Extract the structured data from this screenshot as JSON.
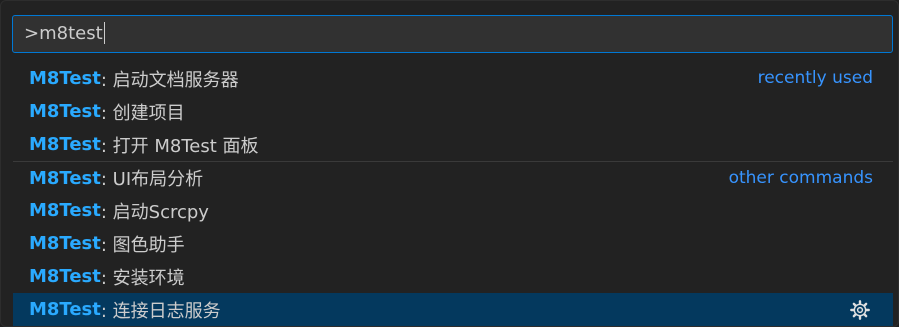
{
  "input": {
    "value": ">m8test"
  },
  "items": [
    {
      "prefix": "M8Test",
      "label": ": 启动文档服务器",
      "group": "recently used"
    },
    {
      "prefix": "M8Test",
      "label": ": 创建项目"
    },
    {
      "prefix": "M8Test",
      "label": ": 打开 M8Test 面板"
    },
    {
      "prefix": "M8Test",
      "label": ": UI布局分析",
      "group": "other commands"
    },
    {
      "prefix": "M8Test",
      "label": ": 启动Scrcpy"
    },
    {
      "prefix": "M8Test",
      "label": ": 图色助手"
    },
    {
      "prefix": "M8Test",
      "label": ": 安装环境"
    },
    {
      "prefix": "M8Test",
      "label": ": 连接日志服务",
      "selected": true,
      "action_icon": "gear-icon"
    }
  ],
  "colors": {
    "accent": "#0078d4",
    "highlight": "#2aaaff",
    "group_label": "#3794ff",
    "selected_bg": "#04395e"
  }
}
